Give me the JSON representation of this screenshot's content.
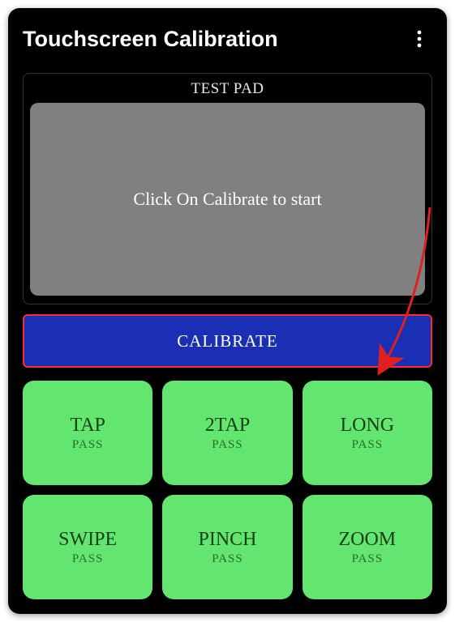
{
  "header": {
    "title": "Touchscreen Calibration"
  },
  "testpad": {
    "label": "TEST PAD",
    "message": "Click On Calibrate to start"
  },
  "calibrate": {
    "label": "CALIBRATE"
  },
  "tiles": [
    {
      "title": "TAP",
      "status": "PASS"
    },
    {
      "title": "2TAP",
      "status": "PASS"
    },
    {
      "title": "LONG",
      "status": "PASS"
    },
    {
      "title": "SWIPE",
      "status": "PASS"
    },
    {
      "title": "PINCH",
      "status": "PASS"
    },
    {
      "title": "ZOOM",
      "status": "PASS"
    }
  ],
  "colors": {
    "accent_blue": "#1b2fb5",
    "highlight_red": "#ff2a2a",
    "pass_green": "#63e66f"
  }
}
